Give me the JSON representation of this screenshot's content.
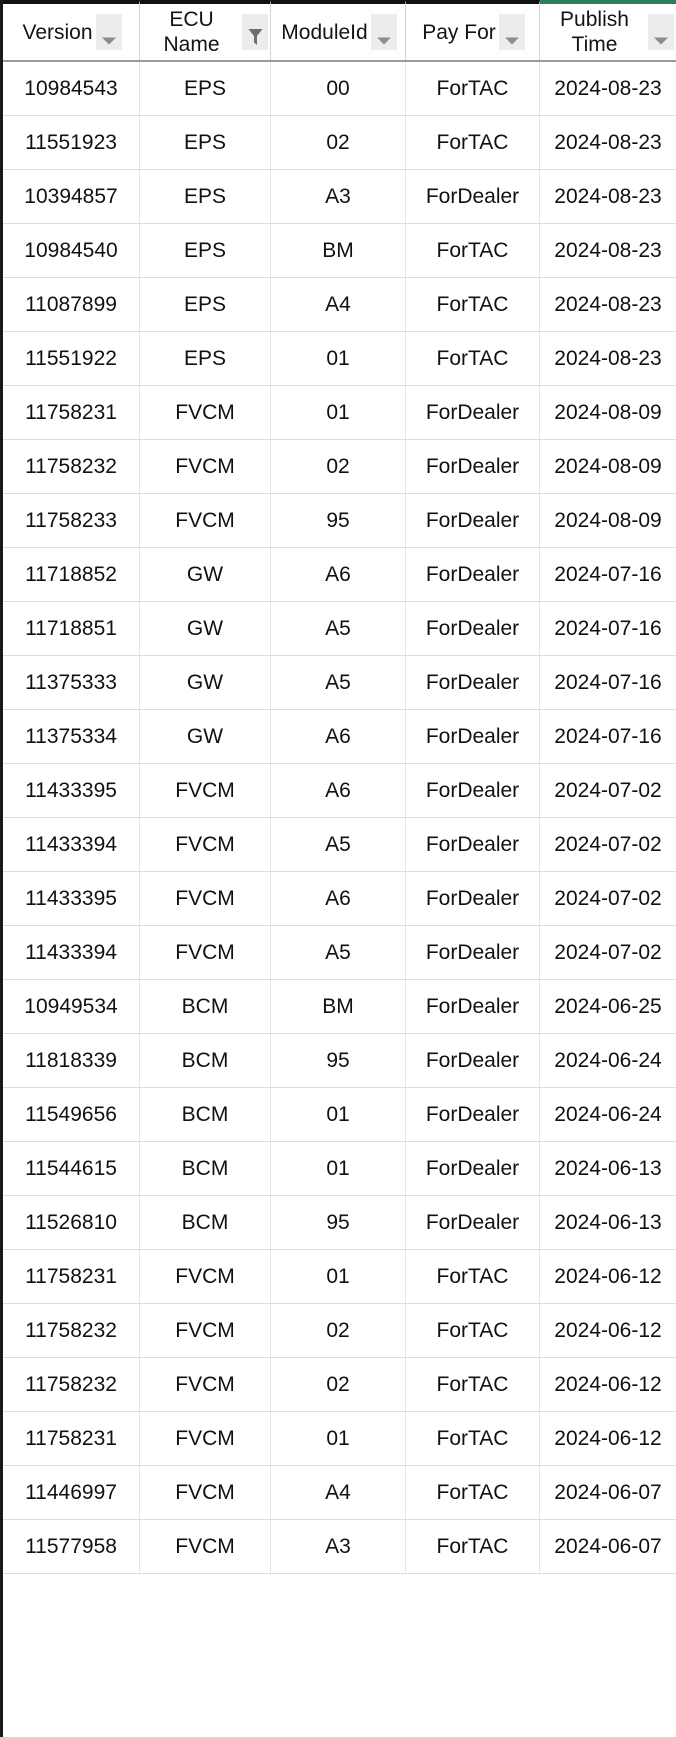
{
  "table": {
    "accent_sorted_border": "#2e7d5b",
    "header_border": "#111111",
    "columns": [
      {
        "label": "Version",
        "icon": "chevron-down-icon",
        "sorted": false,
        "filtered": false
      },
      {
        "label": "ECU Name",
        "icon": "filter-funnel-icon",
        "sorted": false,
        "filtered": true
      },
      {
        "label": "ModuleId",
        "icon": "chevron-down-icon",
        "sorted": false,
        "filtered": false
      },
      {
        "label": "Pay For",
        "icon": "chevron-down-icon",
        "sorted": false,
        "filtered": false
      },
      {
        "label": "Publish Time",
        "icon": "chevron-down-icon",
        "sorted": true,
        "filtered": false
      }
    ],
    "rows": [
      {
        "version": "10984543",
        "ecu_name": "EPS",
        "module_id": "00",
        "pay_for": "ForTAC",
        "publish_time": "2024-08-23"
      },
      {
        "version": "11551923",
        "ecu_name": "EPS",
        "module_id": "02",
        "pay_for": "ForTAC",
        "publish_time": "2024-08-23"
      },
      {
        "version": "10394857",
        "ecu_name": "EPS",
        "module_id": "A3",
        "pay_for": "ForDealer",
        "publish_time": "2024-08-23"
      },
      {
        "version": "10984540",
        "ecu_name": "EPS",
        "module_id": "BM",
        "pay_for": "ForTAC",
        "publish_time": "2024-08-23"
      },
      {
        "version": "11087899",
        "ecu_name": "EPS",
        "module_id": "A4",
        "pay_for": "ForTAC",
        "publish_time": "2024-08-23"
      },
      {
        "version": "11551922",
        "ecu_name": "EPS",
        "module_id": "01",
        "pay_for": "ForTAC",
        "publish_time": "2024-08-23"
      },
      {
        "version": "11758231",
        "ecu_name": "FVCM",
        "module_id": "01",
        "pay_for": "ForDealer",
        "publish_time": "2024-08-09"
      },
      {
        "version": "11758232",
        "ecu_name": "FVCM",
        "module_id": "02",
        "pay_for": "ForDealer",
        "publish_time": "2024-08-09"
      },
      {
        "version": "11758233",
        "ecu_name": "FVCM",
        "module_id": "95",
        "pay_for": "ForDealer",
        "publish_time": "2024-08-09"
      },
      {
        "version": "11718852",
        "ecu_name": "GW",
        "module_id": "A6",
        "pay_for": "ForDealer",
        "publish_time": "2024-07-16"
      },
      {
        "version": "11718851",
        "ecu_name": "GW",
        "module_id": "A5",
        "pay_for": "ForDealer",
        "publish_time": "2024-07-16"
      },
      {
        "version": "11375333",
        "ecu_name": "GW",
        "module_id": "A5",
        "pay_for": "ForDealer",
        "publish_time": "2024-07-16"
      },
      {
        "version": "11375334",
        "ecu_name": "GW",
        "module_id": "A6",
        "pay_for": "ForDealer",
        "publish_time": "2024-07-16"
      },
      {
        "version": "11433395",
        "ecu_name": "FVCM",
        "module_id": "A6",
        "pay_for": "ForDealer",
        "publish_time": "2024-07-02"
      },
      {
        "version": "11433394",
        "ecu_name": "FVCM",
        "module_id": "A5",
        "pay_for": "ForDealer",
        "publish_time": "2024-07-02"
      },
      {
        "version": "11433395",
        "ecu_name": "FVCM",
        "module_id": "A6",
        "pay_for": "ForDealer",
        "publish_time": "2024-07-02"
      },
      {
        "version": "11433394",
        "ecu_name": "FVCM",
        "module_id": "A5",
        "pay_for": "ForDealer",
        "publish_time": "2024-07-02"
      },
      {
        "version": "10949534",
        "ecu_name": "BCM",
        "module_id": "BM",
        "pay_for": "ForDealer",
        "publish_time": "2024-06-25"
      },
      {
        "version": "11818339",
        "ecu_name": "BCM",
        "module_id": "95",
        "pay_for": "ForDealer",
        "publish_time": "2024-06-24"
      },
      {
        "version": "11549656",
        "ecu_name": "BCM",
        "module_id": "01",
        "pay_for": "ForDealer",
        "publish_time": "2024-06-24"
      },
      {
        "version": "11544615",
        "ecu_name": "BCM",
        "module_id": "01",
        "pay_for": "ForDealer",
        "publish_time": "2024-06-13"
      },
      {
        "version": "11526810",
        "ecu_name": "BCM",
        "module_id": "95",
        "pay_for": "ForDealer",
        "publish_time": "2024-06-13"
      },
      {
        "version": "11758231",
        "ecu_name": "FVCM",
        "module_id": "01",
        "pay_for": "ForTAC",
        "publish_time": "2024-06-12"
      },
      {
        "version": "11758232",
        "ecu_name": "FVCM",
        "module_id": "02",
        "pay_for": "ForTAC",
        "publish_time": "2024-06-12"
      },
      {
        "version": "11758232",
        "ecu_name": "FVCM",
        "module_id": "02",
        "pay_for": "ForTAC",
        "publish_time": "2024-06-12"
      },
      {
        "version": "11758231",
        "ecu_name": "FVCM",
        "module_id": "01",
        "pay_for": "ForTAC",
        "publish_time": "2024-06-12"
      },
      {
        "version": "11446997",
        "ecu_name": "FVCM",
        "module_id": "A4",
        "pay_for": "ForTAC",
        "publish_time": "2024-06-07"
      },
      {
        "version": "11577958",
        "ecu_name": "FVCM",
        "module_id": "A3",
        "pay_for": "ForTAC",
        "publish_time": "2024-06-07"
      }
    ]
  }
}
